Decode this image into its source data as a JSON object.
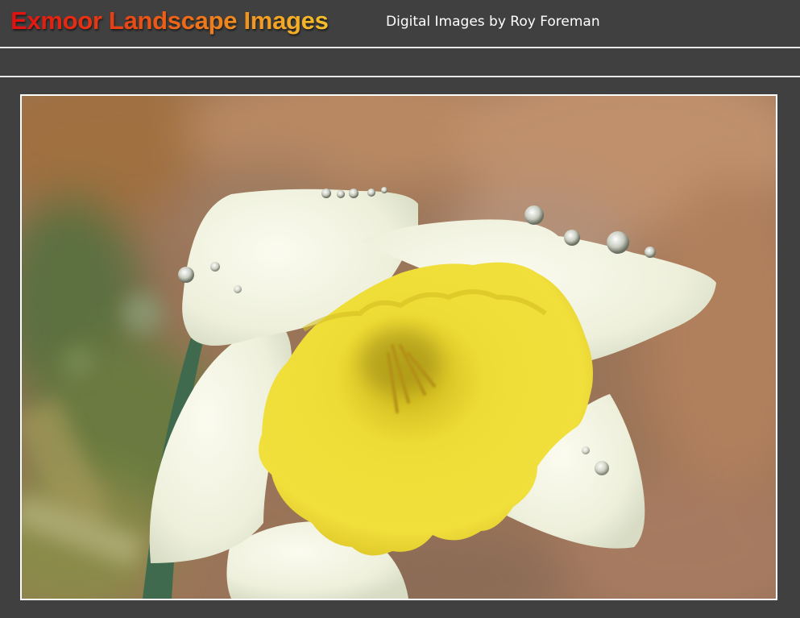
{
  "header": {
    "site_title": "Exmoor Landscape Images",
    "tagline": "Digital Images by Roy Foreman"
  },
  "photo": {
    "subject_icon": "daffodil-photo"
  },
  "colors": {
    "background": "#404040",
    "rule": "#e8e8e8",
    "title_gradient_start": "#e01010",
    "title_gradient_end": "#f6c02a"
  }
}
